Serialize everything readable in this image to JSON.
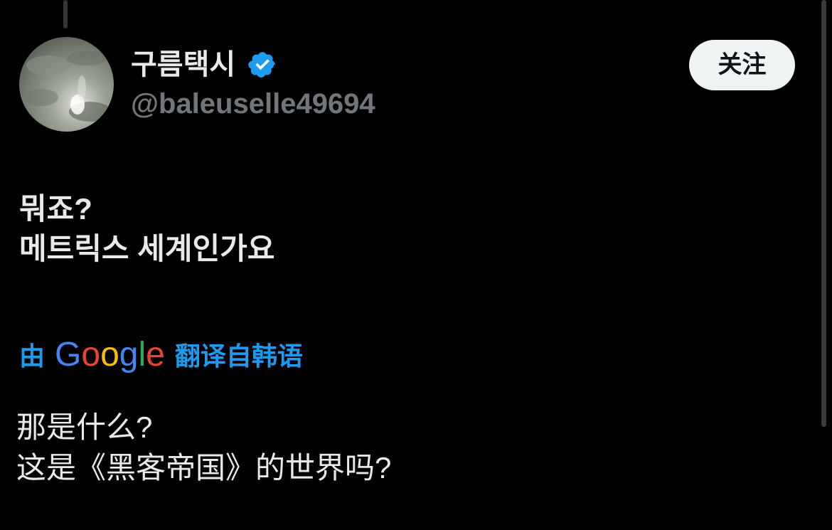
{
  "author": {
    "display_name": "구름택시",
    "handle": "@baleuselle49694",
    "verified": true,
    "verified_color": "#1d9bf0"
  },
  "follow_button": {
    "label": "关注"
  },
  "tweet": {
    "lines": [
      "뭐죠?",
      "메트릭스 세계인가요"
    ]
  },
  "translation": {
    "prefix": "由",
    "provider": "Google",
    "suffix": "翻译自韩语",
    "lines": [
      "那是什么?",
      "这是《黑客帝国》的世界吗?"
    ]
  },
  "colors": {
    "background": "#000000",
    "text": "#e7e9ea",
    "secondary_text": "#71767b",
    "accent": "#1d9bf0"
  },
  "icons": [
    "verified-badge-icon",
    "google-logo"
  ]
}
